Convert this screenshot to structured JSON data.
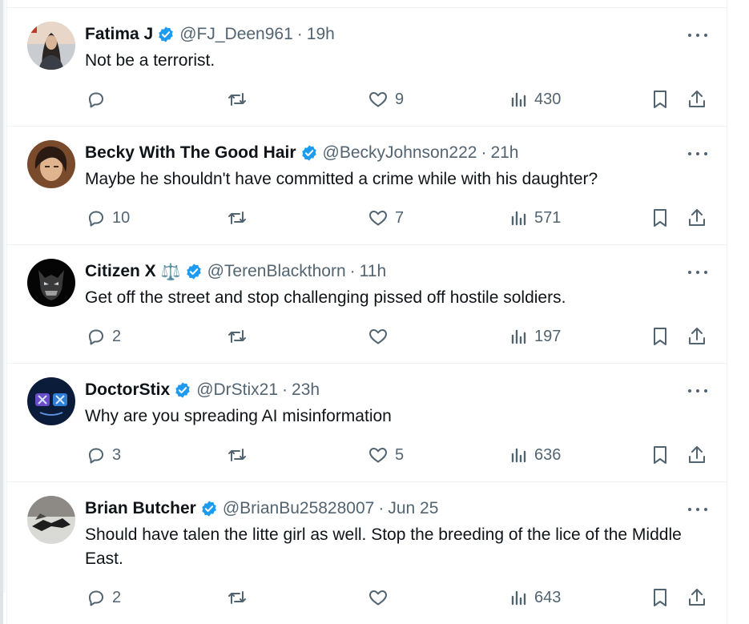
{
  "tweets": [
    {
      "name": "Fatima J",
      "emoji": "",
      "handle": "@FJ_Deen961",
      "time": "19h",
      "text": "Not be a terrorist.",
      "replies": "",
      "reposts": "",
      "likes": "9",
      "views": "430"
    },
    {
      "name": "Becky With The Good Hair",
      "emoji": "",
      "handle": "@BeckyJohnson222",
      "time": "21h",
      "text": "Maybe he shouldn't have committed a crime while with his daughter?",
      "replies": "10",
      "reposts": "",
      "likes": "7",
      "views": "571"
    },
    {
      "name": "Citizen X",
      "emoji": "⚖️",
      "handle": "@TerenBlackthorn",
      "time": "11h",
      "text": "Get off the street and stop challenging pissed off hostile soldiers.",
      "replies": "2",
      "reposts": "",
      "likes": "",
      "views": "197"
    },
    {
      "name": "DoctorStix",
      "emoji": "",
      "handle": "@DrStix21",
      "time": "23h",
      "text": "Why are you spreading AI misinformation",
      "replies": "3",
      "reposts": "",
      "likes": "5",
      "views": "636"
    },
    {
      "name": "Brian Butcher",
      "emoji": "",
      "handle": "@BrianBu25828007",
      "time": "Jun 25",
      "text": "Should have talen the litte girl as well.  Stop the breeding of the lice of the Middle East.",
      "replies": "2",
      "reposts": "",
      "likes": "",
      "views": "643"
    }
  ],
  "colors": {
    "verified": "#1d9bf0",
    "secondary_text": "#536471",
    "primary_text": "#0f1419",
    "divider": "#eff3f4"
  },
  "icons": {
    "reply": "reply-icon",
    "repost": "repost-icon",
    "like": "heart-icon",
    "views": "analytics-icon",
    "bookmark": "bookmark-icon",
    "share": "share-icon",
    "more": "more-icon",
    "verified": "verified-badge-icon"
  }
}
